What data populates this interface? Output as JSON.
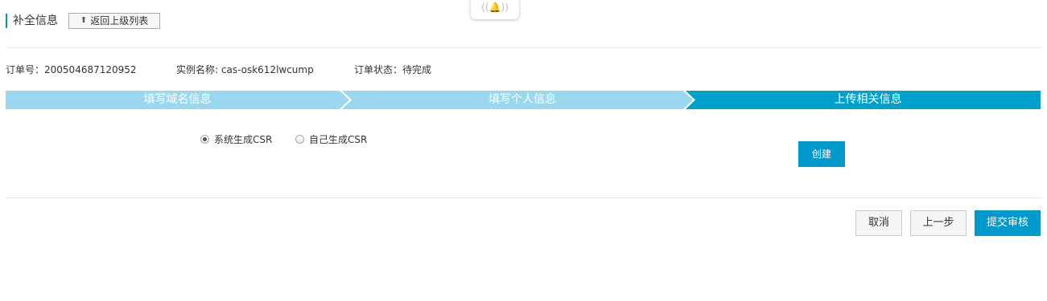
{
  "header": {
    "title": "补全信息",
    "back_label": "返回上级列表",
    "back_icon": "upload-arrow-icon"
  },
  "notification": {
    "icon": "bell-signal-icon"
  },
  "order": {
    "number_label": "订单号：",
    "number": "200504687120952",
    "instance_label": "实例名称: ",
    "instance": "cas-osk612lwcump",
    "status_label": "订单状态：",
    "status": "待完成"
  },
  "steps": [
    {
      "label": "填写域名信息",
      "state": "done"
    },
    {
      "label": "填写个人信息",
      "state": "done"
    },
    {
      "label": "上传相关信息",
      "state": "active"
    }
  ],
  "csr_options": {
    "system": "系统生成CSR",
    "self": "自己生成CSR",
    "selected": "system"
  },
  "create_label": "创建",
  "footer": {
    "cancel": "取消",
    "prev": "上一步",
    "submit": "提交审核"
  },
  "colors": {
    "accent": "#0099cc",
    "step_done": "#99d8ee",
    "step_active": "#00a0cc"
  }
}
